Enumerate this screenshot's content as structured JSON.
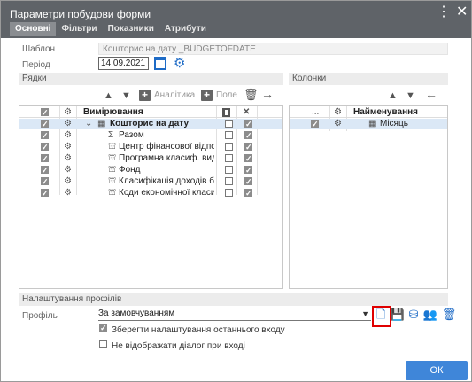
{
  "window": {
    "title": "Параметри побудови форми"
  },
  "tabs": [
    {
      "label": "Основні",
      "active": true
    },
    {
      "label": "Фільтри"
    },
    {
      "label": "Показники"
    },
    {
      "label": "Атрибути"
    }
  ],
  "form": {
    "template_label": "Шаблон",
    "template_value": "Кошторис на дату _BUDGETOFDATE",
    "period_label": "Період",
    "period_value": "14.09.2021"
  },
  "rows_section": {
    "title": "Рядки",
    "add_analytics": "Аналітика",
    "add_field": "Поле",
    "header_dimensions": "Вимірювання",
    "items": [
      {
        "label": "Кошторис на дату",
        "checked": true,
        "bold": true,
        "col3": false,
        "col4": true
      },
      {
        "label": "Разом",
        "checked": true,
        "col3": false,
        "col4": true
      },
      {
        "label": "Центр фінансової відповід",
        "checked": true,
        "col3": false,
        "col4": true
      },
      {
        "label": "Програмна класиф. видат",
        "checked": true,
        "col3": false,
        "col4": true
      },
      {
        "label": "Фонд",
        "checked": true,
        "col3": false,
        "col4": true
      },
      {
        "label": "Класифікація доходів бюд",
        "checked": true,
        "col3": false,
        "col4": true
      },
      {
        "label": "Коди економічної класиф",
        "checked": true,
        "col3": false,
        "col4": true
      }
    ]
  },
  "columns_section": {
    "title": "Колонки",
    "header_name": "Найменування",
    "header_dots": "...",
    "items": [
      {
        "label": "Місяць",
        "checked": true
      }
    ]
  },
  "profile_section": {
    "title": "Налаштування профілів",
    "profile_label": "Профіль",
    "profile_value": "За замовчуванням",
    "save_last_login": "Зберегти налаштування останнього входу",
    "save_last_login_checked": true,
    "hide_dialog": "Не відображати діалог при вході",
    "hide_dialog_checked": false
  },
  "footer": {
    "ok_label": "ОК"
  },
  "colors": {
    "titlebar": "#5f6368",
    "accent": "#3f86d9",
    "highlight": "#e00000"
  }
}
